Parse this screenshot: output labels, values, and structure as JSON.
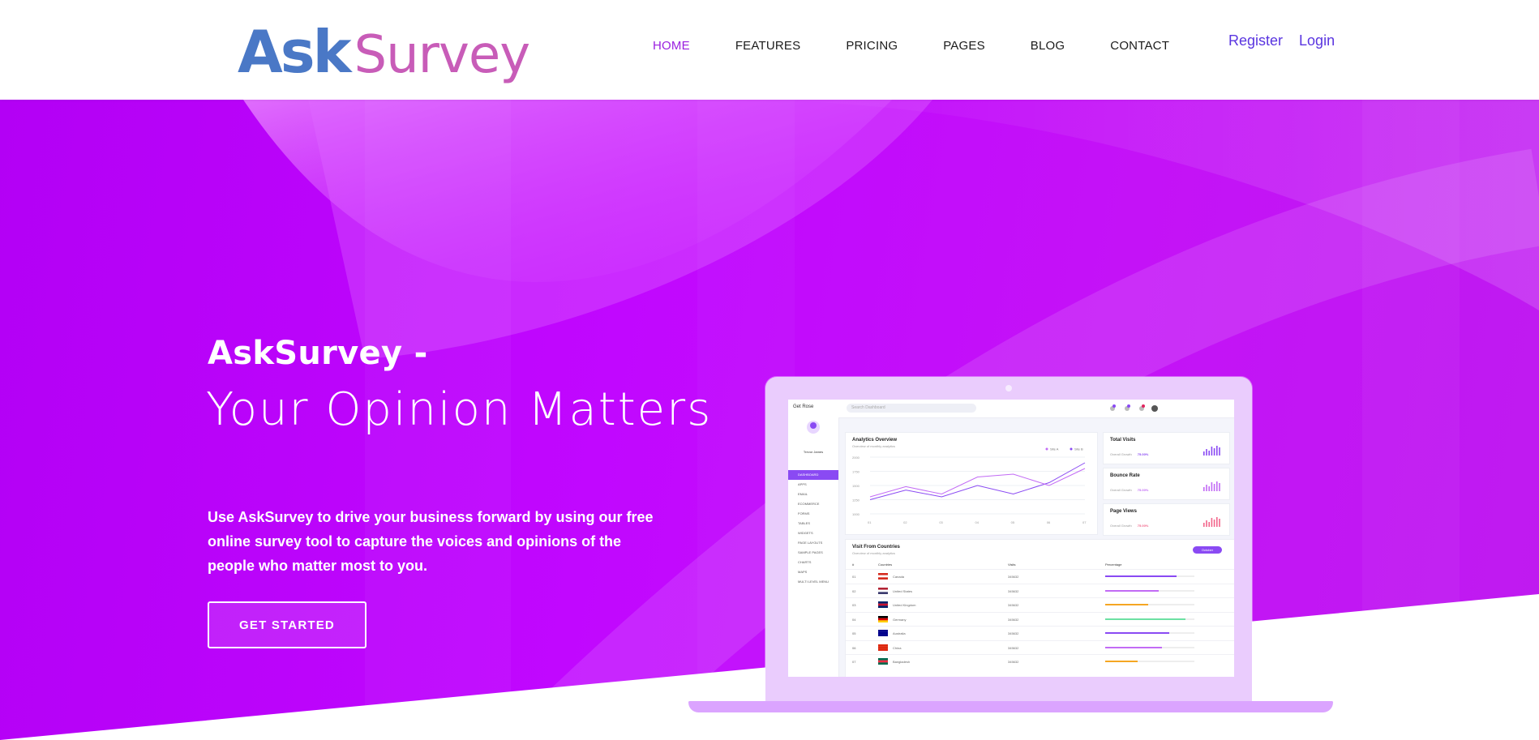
{
  "brand": {
    "ask": "Ask",
    "survey": "Survey",
    "ask_color": "#4a78c6",
    "survey_color": "#c85cb8"
  },
  "nav": {
    "items": [
      {
        "label": "HOME",
        "active": true
      },
      {
        "label": "FEATURES",
        "active": false
      },
      {
        "label": "PRICING",
        "active": false
      },
      {
        "label": "PAGES",
        "active": false
      },
      {
        "label": "BLOG",
        "active": false
      },
      {
        "label": "CONTACT",
        "active": false
      }
    ],
    "register": "Register",
    "login": "Login"
  },
  "hero": {
    "title_1": "AskSurvey -",
    "title_2": "Your Opinion Matters",
    "text": "Use AskSurvey to drive your business forward by using our free online survey tool to capture the voices and opinions of the people who matter most to you.",
    "cta": "GET STARTED",
    "bg_color": "#c107ff"
  },
  "mock": {
    "dash_logo": "Get Rose",
    "search_placeholder": "Search Dashboard",
    "breadcrumb": "DASHBOARD",
    "breadcrumb_right": "Home ▸ Dashboard",
    "user_name": "Trevor James",
    "sidebar": [
      "DASHBOARD",
      "APPS",
      "EMAIL",
      "ECOMMERCE",
      "FORMS",
      "TABLES",
      "WIDGETS",
      "PAGE LAYOUTS",
      "SAMPLE PAGES",
      "CHARTS",
      "MAPS",
      "MULTI LEVEL MENU"
    ],
    "analytics_title": "Analytics Overview",
    "analytics_sub": "Overview of monthly analytics",
    "legend": [
      "Site A",
      "Site B"
    ],
    "y_ticks": [
      "2000",
      "1750",
      "1500",
      "1250",
      "1000"
    ],
    "x_ticks": [
      "01",
      "02",
      "03",
      "04",
      "05",
      "06",
      "07"
    ],
    "line_a": [
      1250,
      1420,
      1300,
      1500,
      1350,
      1550,
      1900
    ],
    "line_b": [
      1300,
      1480,
      1350,
      1650,
      1700,
      1500,
      1800
    ],
    "stats": [
      {
        "title": "Total Visits",
        "sub": "Overall Growth",
        "value": "75.00%",
        "color": "#8a4af3"
      },
      {
        "title": "Bounce Rate",
        "sub": "Overall Growth",
        "value": "75.00%",
        "color": "#c26bf5"
      },
      {
        "title": "Page Views",
        "sub": "Overall Growth",
        "value": "75.00%",
        "color": "#f2668b"
      }
    ],
    "countries_title": "Visit From Countries",
    "countries_sub": "Overview of monthly analytics",
    "countries_btn": "October",
    "columns": [
      "#",
      "Countries",
      "Visits",
      "Percentage"
    ],
    "countries": [
      {
        "n": "01",
        "name": "Canada",
        "visits": "345632",
        "pct": 80,
        "color": "#8a4af3"
      },
      {
        "n": "02",
        "name": "United States",
        "visits": "345632",
        "pct": 60,
        "color": "#c26bf5"
      },
      {
        "n": "03",
        "name": "United Kingdom",
        "visits": "345632",
        "pct": 48,
        "color": "#f5a623"
      },
      {
        "n": "04",
        "name": "Germany",
        "visits": "345632",
        "pct": 90,
        "color": "#6de0a3"
      },
      {
        "n": "05",
        "name": "Australia",
        "visits": "345632",
        "pct": 72,
        "color": "#8a4af3"
      },
      {
        "n": "06",
        "name": "China",
        "visits": "345632",
        "pct": 64,
        "color": "#c26bf5"
      },
      {
        "n": "07",
        "name": "Bangladesh",
        "visits": "345632",
        "pct": 36,
        "color": "#f5a623"
      }
    ]
  }
}
